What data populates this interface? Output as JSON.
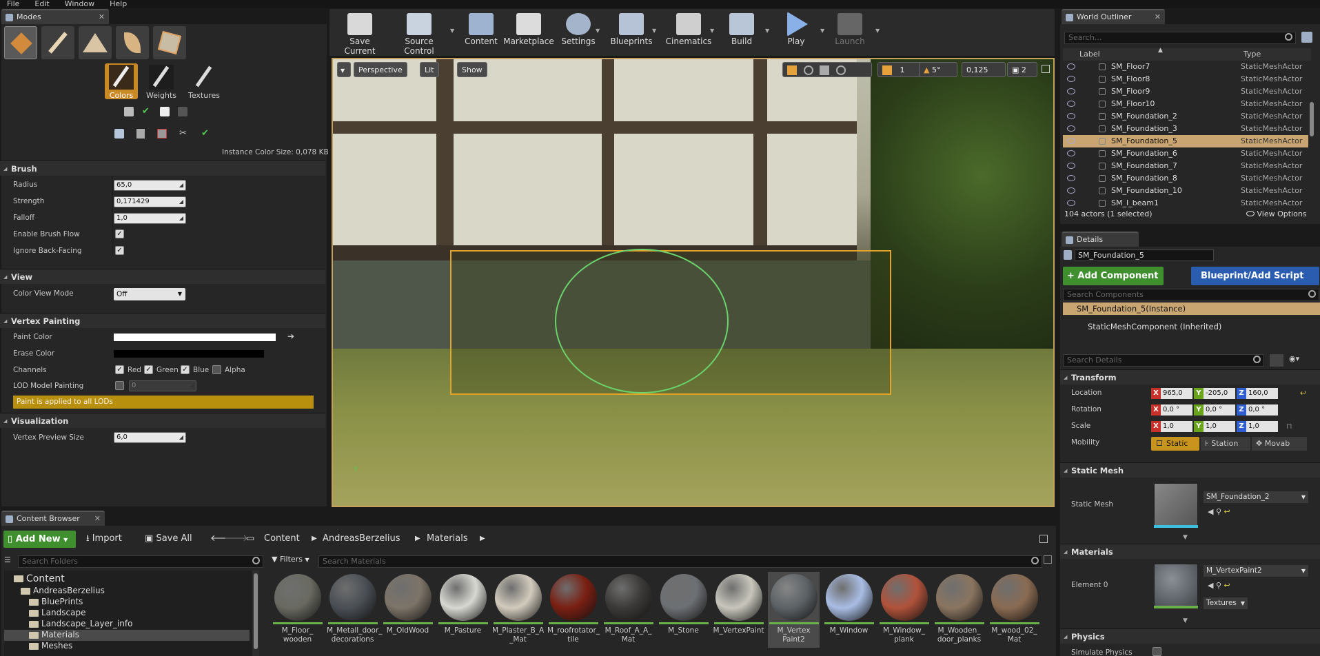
{
  "menu": [
    "File",
    "Edit",
    "Window",
    "Help"
  ],
  "modes": {
    "tab_title": "Modes",
    "subtools": [
      "Colors",
      "Weights",
      "Textures"
    ],
    "instance_info": "Instance Color Size: 0,078 KB",
    "brush": {
      "title": "Brush",
      "radius_label": "Radius",
      "radius_value": "65,0",
      "strength_label": "Strength",
      "strength_value": "0,171429",
      "falloff_label": "Falloff",
      "falloff_value": "1,0",
      "flow_label": "Enable Brush Flow",
      "backfacing_label": "Ignore Back-Facing"
    },
    "view": {
      "title": "View",
      "color_view_label": "Color View Mode",
      "color_view_value": "Off"
    },
    "vertex": {
      "title": "Vertex Painting",
      "paint_color_label": "Paint Color",
      "erase_color_label": "Erase Color",
      "channels_label": "Channels",
      "channels": [
        "Red",
        "Green",
        "Blue",
        "Alpha"
      ],
      "lod_label": "LOD Model Painting",
      "lod_value": "0",
      "lod_note": "Paint is applied to all LODs",
      "paint_color": "#ffffff",
      "erase_color": "#000000"
    },
    "visualization": {
      "title": "Visualization",
      "preview_label": "Vertex Preview Size",
      "preview_value": "6,0"
    }
  },
  "toolbar": [
    "Save Current",
    "Source Control",
    "Content",
    "Marketplace",
    "Settings",
    "Blueprints",
    "Cinematics",
    "Build",
    "Play",
    "Launch"
  ],
  "viewport": {
    "perspective": "Perspective",
    "lit": "Lit",
    "show": "Show",
    "angle": "5°",
    "scale": "0,125",
    "speed": "2",
    "grid": "1"
  },
  "outliner": {
    "tab_title": "World Outliner",
    "search_placeholder": "Search...",
    "col_label": "Label",
    "col_type": "Type",
    "rows": [
      {
        "name": "SM_Floor7",
        "type": "StaticMeshActor"
      },
      {
        "name": "SM_Floor8",
        "type": "StaticMeshActor"
      },
      {
        "name": "SM_Floor9",
        "type": "StaticMeshActor"
      },
      {
        "name": "SM_Floor10",
        "type": "StaticMeshActor"
      },
      {
        "name": "SM_Foundation_2",
        "type": "StaticMeshActor"
      },
      {
        "name": "SM_Foundation_3",
        "type": "StaticMeshActor"
      },
      {
        "name": "SM_Foundation_5",
        "type": "StaticMeshActor"
      },
      {
        "name": "SM_Foundation_6",
        "type": "StaticMeshActor"
      },
      {
        "name": "SM_Foundation_7",
        "type": "StaticMeshActor"
      },
      {
        "name": "SM_Foundation_8",
        "type": "StaticMeshActor"
      },
      {
        "name": "SM_Foundation_10",
        "type": "StaticMeshActor"
      },
      {
        "name": "SM_I_beam1",
        "type": "StaticMeshActor"
      }
    ],
    "status": "104 actors (1 selected)",
    "view_options": "View Options"
  },
  "details": {
    "tab_title": "Details",
    "actor_name": "SM_Foundation_5",
    "add_component": "+ Add Component",
    "blueprint": "Blueprint/Add Script",
    "search_components": "Search Components",
    "instance": "SM_Foundation_5(Instance)",
    "component": "StaticMeshComponent (Inherited)",
    "search_details": "Search Details",
    "transform": {
      "title": "Transform",
      "location_label": "Location",
      "location": [
        "965,0",
        "-205,0",
        "160,0"
      ],
      "rotation_label": "Rotation",
      "rotation": [
        "0,0 °",
        "0,0 °",
        "0,0 °"
      ],
      "scale_label": "Scale",
      "scale": [
        "1,0",
        "1,0",
        "1,0"
      ],
      "mobility_label": "Mobility",
      "mobility": [
        "Static",
        "Station",
        "Movab"
      ]
    },
    "static_mesh": {
      "title": "Static Mesh",
      "label": "Static Mesh",
      "value": "SM_Foundation_2"
    },
    "materials": {
      "title": "Materials",
      "label": "Element 0",
      "value": "M_VertexPaint2",
      "textures": "Textures"
    },
    "physics": {
      "title": "Physics",
      "simulate": "Simulate Physics"
    }
  },
  "content_browser": {
    "tab_title": "Content Browser",
    "add_new": "Add New",
    "import": "Import",
    "save_all": "Save All",
    "path": [
      "Content",
      "AndreasBerzelius",
      "Materials"
    ],
    "search_folders": "Search Folders",
    "filters": "Filters",
    "search_materials": "Search Materials",
    "tree": [
      "Content",
      "AndreasBerzelius",
      "BluePrints",
      "Landscape",
      "Landscape_Layer_info",
      "Materials",
      "Meshes"
    ],
    "materials": [
      {
        "name": "M_Floor_ wooden",
        "color": "#6a6a62"
      },
      {
        "name": "M_Metall_door_ decorations",
        "color": "#4a4f55"
      },
      {
        "name": "M_OldWood",
        "color": "#7d7468"
      },
      {
        "name": "M_Pasture",
        "color": "#d8d8d2"
      },
      {
        "name": "M_Plaster_B_A _Mat",
        "color": "#d2cbbd"
      },
      {
        "name": "M_roofrotator_ tile",
        "color": "#7a1f12"
      },
      {
        "name": "M_Roof_A_A_ Mat",
        "color": "#3c3a38"
      },
      {
        "name": "M_Stone",
        "color": "#6d7074"
      },
      {
        "name": "M_VertexPaint",
        "color": "#c8c6bc"
      },
      {
        "name": "M_Vertex Paint2",
        "color": "#5c6266"
      },
      {
        "name": "M_Window",
        "color": "#a9bde4"
      },
      {
        "name": "M_Window_ plank",
        "color": "#b0523a"
      },
      {
        "name": "M_Wooden_ door_planks",
        "color": "#8a7560"
      },
      {
        "name": "M_wood_02_ Mat",
        "color": "#8a6b52"
      }
    ]
  }
}
